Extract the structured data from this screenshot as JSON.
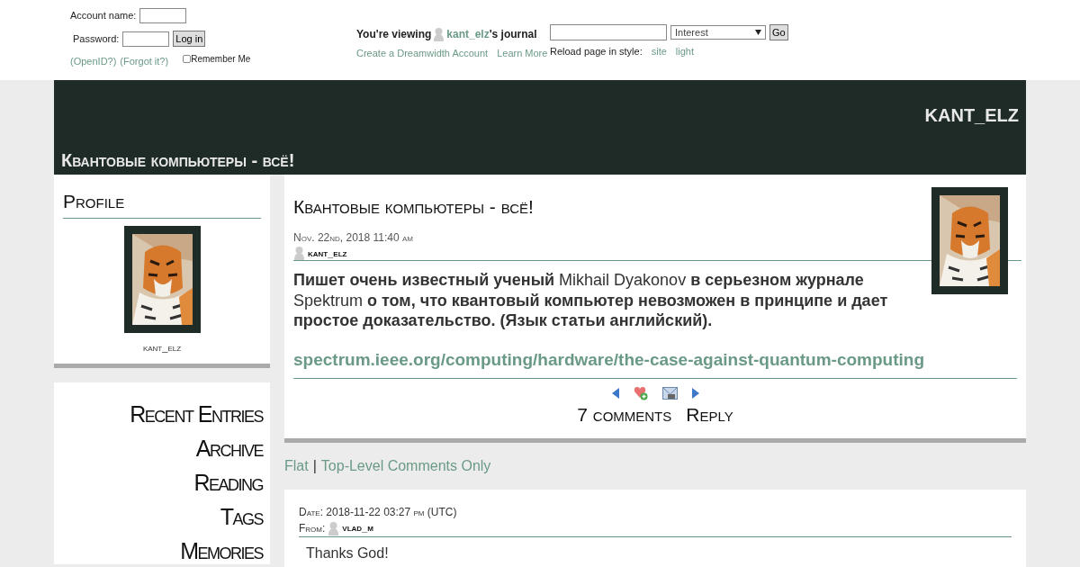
{
  "login": {
    "account_label": "Account name:",
    "password_label": "Password:",
    "button": "Log in",
    "links": [
      "(OpenID?)",
      "(Forgot it?)"
    ],
    "remember": {
      "label": "Remember Me",
      "checked": false
    }
  },
  "viewing": {
    "prefix": "You're viewing",
    "user": "kant_elz",
    "suffix": "'s journal",
    "links": [
      "Create a Dreamwidth Account",
      "Learn More"
    ]
  },
  "search": {
    "select": "Interest",
    "button": "Go",
    "style_label": "Reload page in style:",
    "style_links": [
      "site",
      "light"
    ]
  },
  "header": {
    "username": "KANT_ELZ",
    "title": "Квантовые компьютеры - всё!"
  },
  "profile": {
    "heading": "Profile",
    "name": "kant_elz"
  },
  "nav": [
    "Recent Entries",
    "Archive",
    "Reading",
    "Tags",
    "Memories"
  ],
  "entry": {
    "title": "Квантовые компьютеры - всё!",
    "date": "Nov. 22nd, 2018 11:40 am",
    "author": "kant_elz",
    "body": "**Пишет очень известный ученый** Mikhail Dyakonov **в серьезном журнале** Spektrum **о том, что квантовый компьютер невозможен в принципе и дает простое доказательство. (Язык статьи английский).**",
    "link": "spectrum.ieee.org/computing/hardware/the-case-against-quantum-computing",
    "comments": "7 comments",
    "reply": "Reply"
  },
  "filters": {
    "items": [
      "Flat",
      "Top-Level Comments Only"
    ],
    "separator": "|"
  },
  "comment": {
    "date": "Date: 2018-11-22 03:27 pm (UTC)",
    "from_label": "From:",
    "user": "vlad_m",
    "body": "Thanks God!"
  }
}
